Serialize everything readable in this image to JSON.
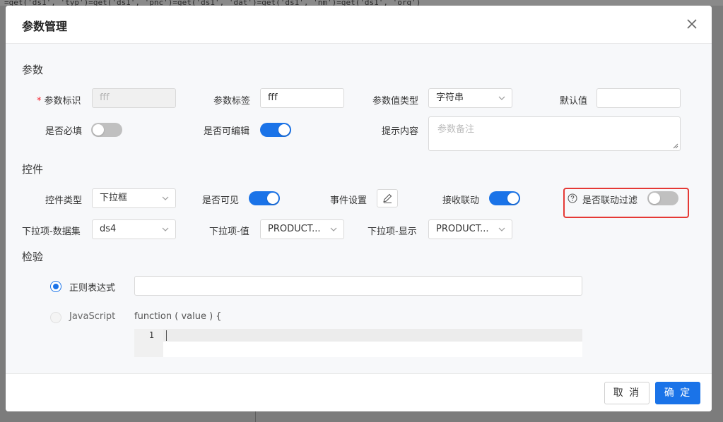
{
  "background": {
    "snippet": "=get('ds1', 'typ')=get('ds1', 'pnc')=get('ds1', 'dat')=get('ds1', 'nm')=get('ds1', 'org')"
  },
  "dialog": {
    "title": "参数管理"
  },
  "sections": {
    "params": "参数",
    "controls": "控件",
    "validation": "检验"
  },
  "param": {
    "id_label": "参数标识",
    "id_value": "fff",
    "tag_label": "参数标签",
    "tag_value": "fff",
    "type_label": "参数值类型",
    "type_value": "字符串",
    "default_label": "默认值",
    "default_value": "",
    "required_label": "是否必填",
    "required": false,
    "editable_label": "是否可编辑",
    "editable": true,
    "hint_label": "提示内容",
    "hint_placeholder": "参数备注"
  },
  "control": {
    "type_label": "控件类型",
    "type_value": "下拉框",
    "visible_label": "是否可见",
    "visible": true,
    "event_label": "事件设置",
    "receive_label": "接收联动",
    "receive": true,
    "filter_label": "是否联动过滤",
    "filter": false,
    "dataset_label": "下拉项-数据集",
    "dataset_value": "ds4",
    "value_label": "下拉项-值",
    "value_value": "PRODUCT...",
    "display_label": "下拉项-显示",
    "display_value": "PRODUCT..."
  },
  "validation": {
    "regex_label": "正则表达式",
    "regex_selected": true,
    "regex_value": "",
    "js_label": "JavaScript",
    "func_signature": "function ( value ) {",
    "line_number": "1"
  },
  "footer": {
    "cancel": "取 消",
    "ok": "确 定"
  },
  "colors": {
    "accent": "#1a73e8",
    "highlight": "#e53935"
  }
}
